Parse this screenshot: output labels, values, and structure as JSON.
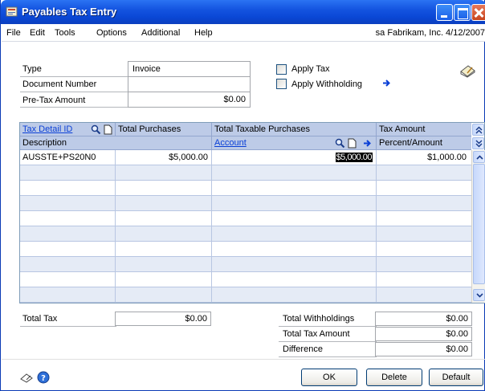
{
  "window": {
    "title": "Payables Tax Entry"
  },
  "menu": {
    "items": [
      "File",
      "Edit",
      "Tools",
      "Options",
      "Additional",
      "Help"
    ],
    "company_info": "sa  Fabrikam, Inc.  4/12/2007"
  },
  "form": {
    "type_label": "Type",
    "type_value": "Invoice",
    "document_number_label": "Document Number",
    "document_number_value": "",
    "pretax_amount_label": "Pre-Tax Amount",
    "pretax_amount_value": "$0.00",
    "apply_tax_label": "Apply Tax",
    "apply_tax_checked": false,
    "apply_withholding_label": "Apply Withholding",
    "apply_withholding_checked": false
  },
  "grid": {
    "headers_row1": {
      "tax_detail_id": "Tax Detail ID",
      "total_purchases": "Total Purchases",
      "total_taxable_purchases": "Total Taxable Purchases",
      "tax_amount": "Tax Amount"
    },
    "headers_row2": {
      "description": "Description",
      "account": "Account",
      "percent_amount": "Percent/Amount"
    },
    "rows": [
      {
        "tax_detail_id": "AUSSTE+PS20N0",
        "total_purchases": "$5,000.00",
        "total_taxable_purchases": "$5,000.00",
        "tax_amount": "$1,000.00"
      }
    ]
  },
  "totals": {
    "total_tax_label": "Total Tax",
    "total_tax_value": "$0.00",
    "total_withholdings_label": "Total Withholdings",
    "total_withholdings_value": "$0.00",
    "total_tax_amount_label": "Total Tax Amount",
    "total_tax_amount_value": "$0.00",
    "difference_label": "Difference",
    "difference_value": "$0.00"
  },
  "buttons": {
    "ok": "OK",
    "delete": "Delete",
    "default": "Default"
  },
  "colors": {
    "title_bar": "#1454e0",
    "grid_header": "#bdcbe7",
    "grid_alt_row": "#e5ebf6",
    "link": "#0a3fd6"
  }
}
